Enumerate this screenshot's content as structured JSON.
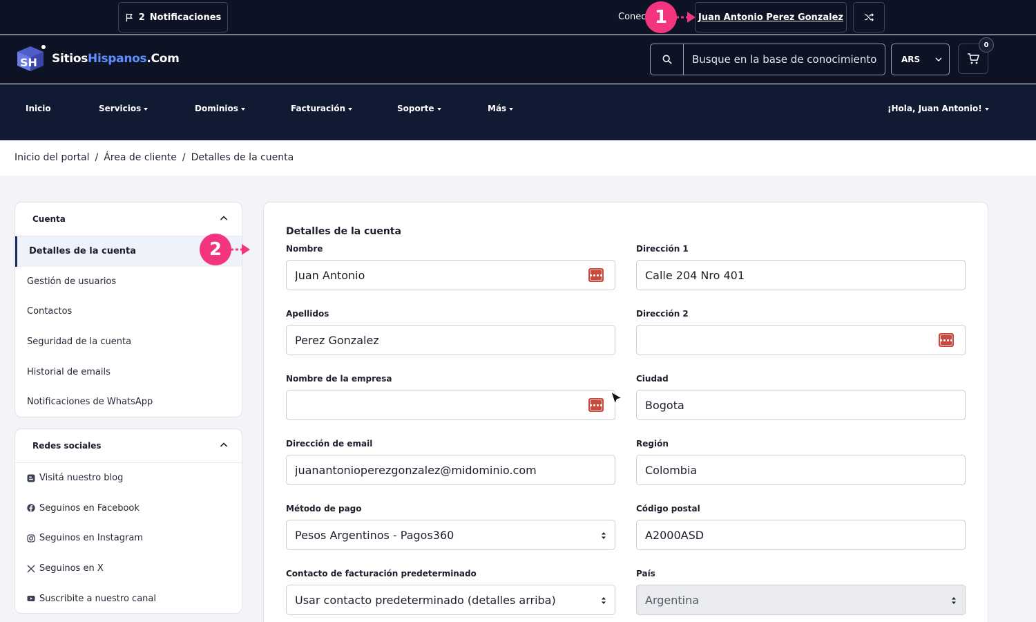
{
  "topbar": {
    "notifications_count": "2",
    "notifications_label": "Notificaciones",
    "connected_text": "Conec",
    "user_name": "Juan Antonio Perez Gonzalez"
  },
  "header": {
    "logo_text_1": "Sitios",
    "logo_text_2": "Hispanos",
    "logo_text_3": ".Com",
    "search_placeholder": "Busque en la base de conocimiento",
    "currency": "ARS",
    "cart_count": "0"
  },
  "nav": {
    "items": [
      {
        "label": "Inicio",
        "dropdown": false
      },
      {
        "label": "Servicios",
        "dropdown": true
      },
      {
        "label": "Dominios",
        "dropdown": true
      },
      {
        "label": "Facturación",
        "dropdown": true
      },
      {
        "label": "Soporte",
        "dropdown": true
      },
      {
        "label": "Más",
        "dropdown": true
      }
    ],
    "greeting": "¡Hola, Juan Antonio!"
  },
  "breadcrumb": [
    "Inicio del portal",
    "Área de cliente",
    "Detalles de la cuenta"
  ],
  "breadcrumb_separator": "/",
  "sidebar": {
    "account": {
      "title": "Cuenta",
      "items": [
        "Detalles de la cuenta",
        "Gestión de usuarios",
        "Contactos",
        "Seguridad de la cuenta",
        "Historial de emails",
        "Notificaciones de WhatsApp"
      ],
      "active_index": 0
    },
    "social": {
      "title": "Redes sociales",
      "items": [
        {
          "label": "Visitá nuestro blog",
          "icon": "blogger-icon"
        },
        {
          "label": "Seguinos en Facebook",
          "icon": "facebook-icon"
        },
        {
          "label": "Seguinos en Instagram",
          "icon": "instagram-icon"
        },
        {
          "label": "Seguinos en X",
          "icon": "x-icon"
        },
        {
          "label": "Suscribite a nuestro canal",
          "icon": "youtube-icon"
        }
      ]
    }
  },
  "form": {
    "title": "Detalles de la cuenta",
    "nombre": {
      "label": "Nombre",
      "value": "Juan Antonio"
    },
    "apellidos": {
      "label": "Apellidos",
      "value": "Perez Gonzalez"
    },
    "empresa": {
      "label": "Nombre de la empresa",
      "value": ""
    },
    "email": {
      "label": "Dirección de email",
      "value": "juanantonioperezgonzalez@midominio.com"
    },
    "metodo_pago": {
      "label": "Método de pago",
      "value": "Pesos Argentinos - Pagos360"
    },
    "contacto_facturacion": {
      "label": "Contacto de facturación predeterminado",
      "value": "Usar contacto predeterminado (detalles arriba)"
    },
    "direccion1": {
      "label": "Dirección 1",
      "value": "Calle 204 Nro 401"
    },
    "direccion2": {
      "label": "Dirección 2",
      "value": ""
    },
    "ciudad": {
      "label": "Ciudad",
      "value": "Bogota"
    },
    "region": {
      "label": "Región",
      "value": "Colombia"
    },
    "codigo_postal": {
      "label": "Código postal",
      "value": "A2000ASD"
    },
    "pais": {
      "label": "País",
      "value": "Argentina"
    }
  },
  "annotations": {
    "step1": "1",
    "step2": "2"
  },
  "colors": {
    "dark_bg": "#0d1324",
    "nav_bg": "#111a33",
    "accent_blue": "#5f8fff",
    "annotation_pink": "#f2357e",
    "password_icon_red": "#c94a3c"
  }
}
